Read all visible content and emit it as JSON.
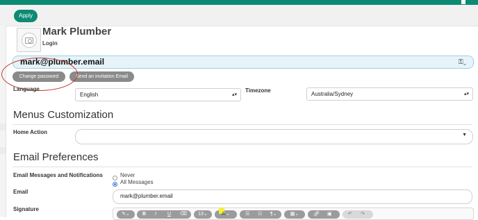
{
  "header": {
    "apply_label": "Apply",
    "accent_color": "#0d8a73"
  },
  "profile": {
    "name": "Mark Plumber",
    "login_label": "Login",
    "login_value": "mark@plumber.email",
    "avatar_icon": "camera-icon",
    "key_icon": "key-icon"
  },
  "actions": {
    "change_password": "Change password",
    "send_invitation": "Send an invitation Email"
  },
  "locale": {
    "language_label": "Language",
    "language_value": "English",
    "timezone_label": "Timezone",
    "timezone_value": "Australia/Sydney"
  },
  "menus": {
    "title": "Menus Customization",
    "home_action_label": "Home Action",
    "home_action_value": ""
  },
  "email_prefs": {
    "title": "Email Preferences",
    "messages_label": "Email Messages and Notifications",
    "options": [
      "Never",
      "All Messages"
    ],
    "selected": "All Messages",
    "email_label": "Email",
    "email_value": "mark@plumber.email",
    "signature_label": "Signature"
  },
  "toolbar": {
    "font_size": "13",
    "bold": "B",
    "italic": "I",
    "underline": "U",
    "undo": "↶",
    "redo": "↷"
  }
}
